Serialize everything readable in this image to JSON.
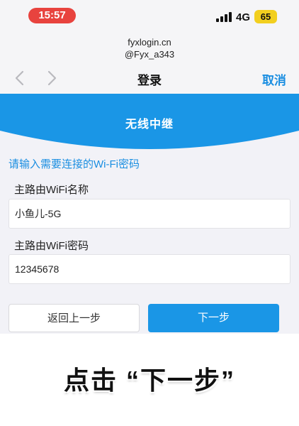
{
  "status_bar": {
    "time": "15:57",
    "network": "4G",
    "battery": "65"
  },
  "browser": {
    "url": "fyxlogin.cn",
    "watermark": "@Fyx_a343"
  },
  "nav": {
    "title": "登录",
    "cancel": "取消"
  },
  "header": {
    "title": "无线中继"
  },
  "form": {
    "prompt": "请输入需要连接的Wi-Fi密码",
    "ssid_label": "主路由WiFi名称",
    "ssid_value": "小鱼儿-5G",
    "password_label": "主路由WiFi密码",
    "password_value": "12345678"
  },
  "buttons": {
    "back": "返回上一步",
    "next": "下一步"
  },
  "caption": "点击 “下一步”",
  "colors": {
    "accent": "#1a96e6",
    "time_pill": "#e8433e",
    "battery": "#f2cf1f"
  }
}
